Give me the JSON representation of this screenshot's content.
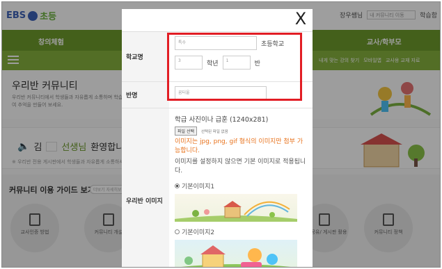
{
  "background": {
    "logo_ebs": "EBS",
    "logo_sub": "초등",
    "user_text": "장우쌤님",
    "user_select": "내 커뮤니티 이동",
    "user_link": "학습함",
    "nav_left": "창의체험",
    "nav_right": "교사/학부모",
    "sub_links": [
      "내게 맞는 강의 찾기",
      "모바일앱",
      "교사용 교재 자료"
    ],
    "hero_title": "우리반 커뮤니티",
    "hero_desc": "우리반 커뮤니티에서 학생들과 자유롭게 소통하며 학습하여 추억을 만들어 보세요.",
    "welcome_prefix": "김",
    "welcome_name": "선생님",
    "welcome_suffix": "환영합니다.",
    "welcome_desc": "※ 우리반 전용 게시판에서 학생들과 자유롭게 소통하세요.",
    "guide_title": "커뮤니티 이용 가이드 보기",
    "guide_pill": "더보기 자세히보기",
    "circles": [
      {
        "label": "교사인증 방법"
      },
      {
        "label": "커뮤니티 개설"
      },
      {
        "label": "정보공유/ 게시판 활용"
      },
      {
        "label": "커뮤니티 정책"
      }
    ]
  },
  "modal": {
    "close_glyph": "X",
    "school": {
      "label": "학교명",
      "name_value": "특수",
      "name_suffix": "초등학교",
      "grade_value": "3",
      "grade_unit": "학년",
      "class_value": "1",
      "class_unit": "반"
    },
    "classname": {
      "label": "반명",
      "value": "꿈터울"
    },
    "image": {
      "label": "우리반 이미지",
      "title": "학급 사진이나 급훈 (1240x281)",
      "file_button": "파일 선택",
      "file_status": "선택된 파일 없음",
      "warning": "이미지는 jpg, png, gif 형식의 이미지만 첨부 가능합니다.",
      "note": "이미지를 설정하지 않으면 기본 이미지로 적용됩니다.",
      "options": [
        {
          "label": "기본이미지1",
          "selected": true
        },
        {
          "label": "기본이미지2",
          "selected": false
        }
      ]
    }
  },
  "colors": {
    "green_dark": "#6e9c2c",
    "green_light": "#86b23e",
    "warning": "#e8721c",
    "highlight": "#e21d24"
  }
}
